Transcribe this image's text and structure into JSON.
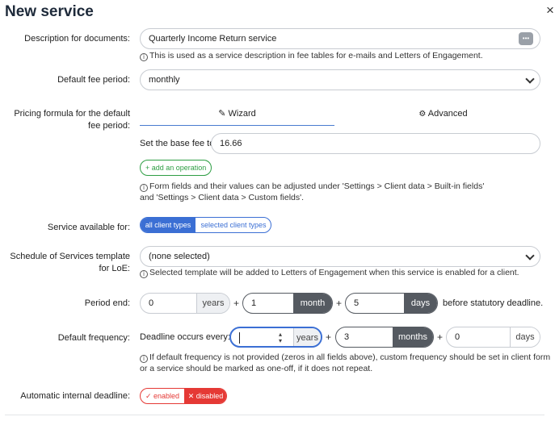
{
  "header": {
    "title": "New service",
    "close": "×"
  },
  "description": {
    "label": "Description for documents:",
    "value": "Quarterly Income Return service",
    "dots": "•••",
    "hint": "This is used as a service description in fee tables for e-mails and Letters of Engagement."
  },
  "fee_period": {
    "label": "Default fee period:",
    "value": "monthly"
  },
  "pricing": {
    "label_line1": "Pricing formula for the default",
    "label_line2": "fee period:",
    "tab_wizard": "Wizard",
    "tab_advanced": "Advanced",
    "base_fee_label": "Set the base fee to:",
    "base_fee_value": "16.66",
    "add_operation": "+ add an operation",
    "hint_line1": "Form fields and their values can be adjusted under 'Settings > Client data > Built-in fields'",
    "hint_line2": "and 'Settings > Client data > Custom fields'."
  },
  "availability": {
    "label": "Service available for:",
    "option_all": "all client types",
    "option_selected": "selected client types"
  },
  "schedule": {
    "label_line1": "Schedule of Services template",
    "label_line2": "for LoE:",
    "value": "(none selected)",
    "hint": "Selected template will be added to Letters of Engagement when this service is enabled for a client."
  },
  "period_end": {
    "label": "Period end:",
    "years_value": "0",
    "years_unit": "years",
    "month_value": "1",
    "month_unit": "month",
    "days_value": "5",
    "days_unit": "days",
    "suffix": "before statutory deadline.",
    "plus": "+"
  },
  "frequency": {
    "label": "Default frequency:",
    "prefix": "Deadline occurs every:",
    "years_value": "",
    "years_unit": "years",
    "months_value": "3",
    "months_unit": "months",
    "days_value": "0",
    "days_unit": "days",
    "hint_line1": "If default frequency is not provided (zeros in all fields above), custom frequency should be set in client form",
    "hint_line2": "or a service should be marked as one-off, if it does not repeat."
  },
  "internal_deadline": {
    "label": "Automatic internal deadline:",
    "enabled": "✓ enabled",
    "disabled": "✕ disabled"
  },
  "colors": {
    "accent": "#3b6fd4",
    "danger": "#e53935",
    "success": "#2e9e44",
    "dark_unit": "#555a61"
  }
}
